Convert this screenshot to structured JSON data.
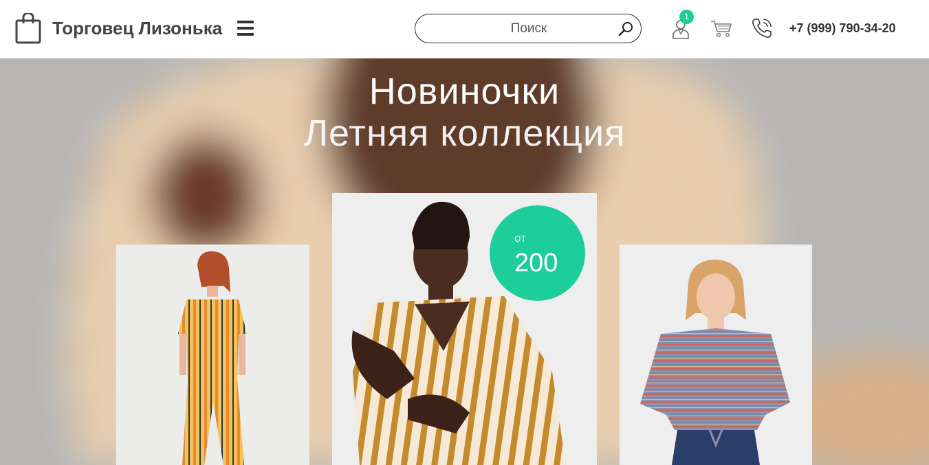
{
  "header": {
    "brand": "Торговец Лизонька",
    "search_placeholder": "Поиск",
    "account_badge": "1",
    "phone": "+7 (999) 790-34-20"
  },
  "hero": {
    "title": "Новиночки",
    "subtitle": "Летняя коллекция",
    "price_prefix": "от",
    "price_value": "200"
  },
  "colors": {
    "accent": "#1dce9a",
    "text_dark": "#444444"
  },
  "icons": [
    "shopping-bag-icon",
    "hamburger-menu-icon",
    "search-icon",
    "user-icon",
    "cart-icon",
    "phone-icon"
  ]
}
